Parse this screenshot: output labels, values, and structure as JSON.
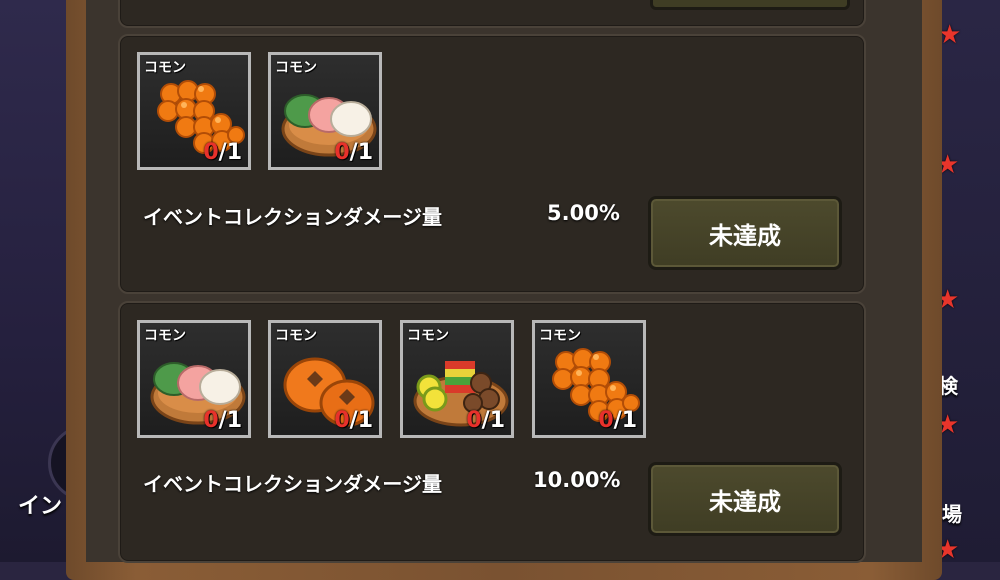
{
  "background": {
    "left_text": "イン",
    "right_text_1": "検",
    "right_text_2": "場"
  },
  "missions": [
    {
      "label": "イベントコレクションダメージ量",
      "value": "5.00%",
      "button": "未達成",
      "items": [
        {
          "rarity": "コモン",
          "have": "0",
          "need": "/1",
          "icon": "orange-ball-cluster-icon"
        },
        {
          "rarity": "コモン",
          "have": "0",
          "need": "/1",
          "icon": "tricolor-rice-cake-icon"
        }
      ]
    },
    {
      "label": "イベントコレクションダメージ量",
      "value": "10.00%",
      "button": "未達成",
      "items": [
        {
          "rarity": "コモン",
          "have": "0",
          "need": "/1",
          "icon": "tricolor-rice-cake-icon"
        },
        {
          "rarity": "コモン",
          "have": "0",
          "need": "/1",
          "icon": "persimmon-icon"
        },
        {
          "rarity": "コモン",
          "have": "0",
          "need": "/1",
          "icon": "skewer-platter-icon"
        },
        {
          "rarity": "コモン",
          "have": "0",
          "need": "/1",
          "icon": "orange-ball-cluster-icon"
        }
      ]
    }
  ],
  "colors": {
    "have_count": "#e8312b",
    "button_bg": "#4d4a2d",
    "frame_wood": "#7a5231"
  }
}
